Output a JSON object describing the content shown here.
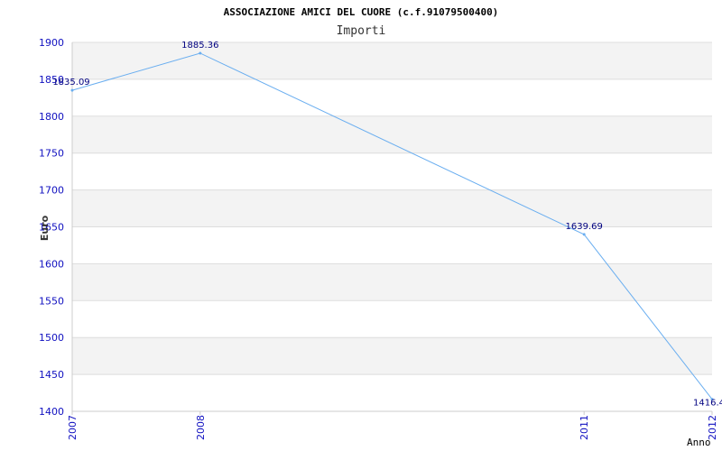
{
  "chart_data": {
    "type": "line",
    "title": "ASSOCIAZIONE AMICI DEL CUORE (c.f.91079500400)",
    "subtitle": "Importi",
    "ylabel": "Euro",
    "xlabel": "Anno",
    "categories": [
      "2007",
      "2008",
      "2011",
      "2012"
    ],
    "values": [
      1835.09,
      1885.36,
      1639.69,
      1416.4
    ],
    "data_labels": [
      "1835.09",
      "1885.36",
      "1639.69",
      "1416.4"
    ],
    "ylim": [
      1400,
      1900
    ],
    "yticks": [
      "1400",
      "1450",
      "1500",
      "1550",
      "1600",
      "1650",
      "1700",
      "1750",
      "1800",
      "1850",
      "1900"
    ],
    "grid": "horizontal",
    "band_colors": [
      "#f3f3f3",
      "#ffffff"
    ],
    "line_color": "#6aaef0",
    "tick_color": "#1010c0",
    "label_color": "#000080"
  }
}
